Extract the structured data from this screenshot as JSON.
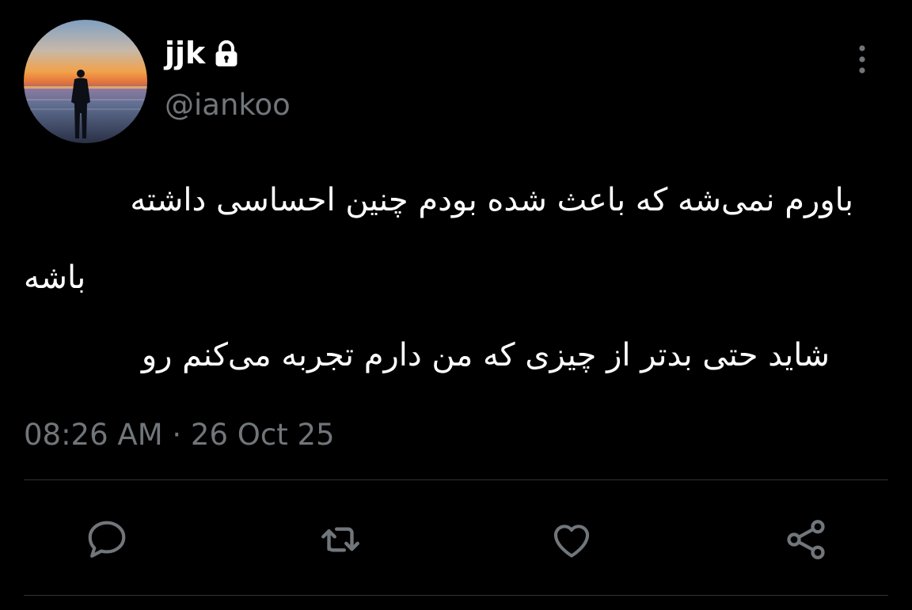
{
  "profile": {
    "display_name": "jjk",
    "handle": "@iankoo",
    "avatar_icon": "sunset-silhouette-avatar",
    "protected_icon": "lock-icon"
  },
  "tweet": {
    "text_line_1": "باورم نمی‌شه که باعث شده بودم چنین احساسی داشته",
    "text_line_2": "باشه",
    "text_line_3": "شاید حتی بدتر از چیزی که من دارم تجربه می‌کنم رو"
  },
  "meta": {
    "timestamp": "08:26 AM · 26 Oct 25"
  },
  "actions": {
    "reply_icon": "reply-icon",
    "retweet_icon": "retweet-icon",
    "like_icon": "heart-icon",
    "share_icon": "share-icon",
    "more_icon": "more-vertical-icon"
  },
  "colors": {
    "background": "#000000",
    "primary_text": "#ffffff",
    "secondary_text": "#71767b",
    "divider": "#2f3336"
  }
}
